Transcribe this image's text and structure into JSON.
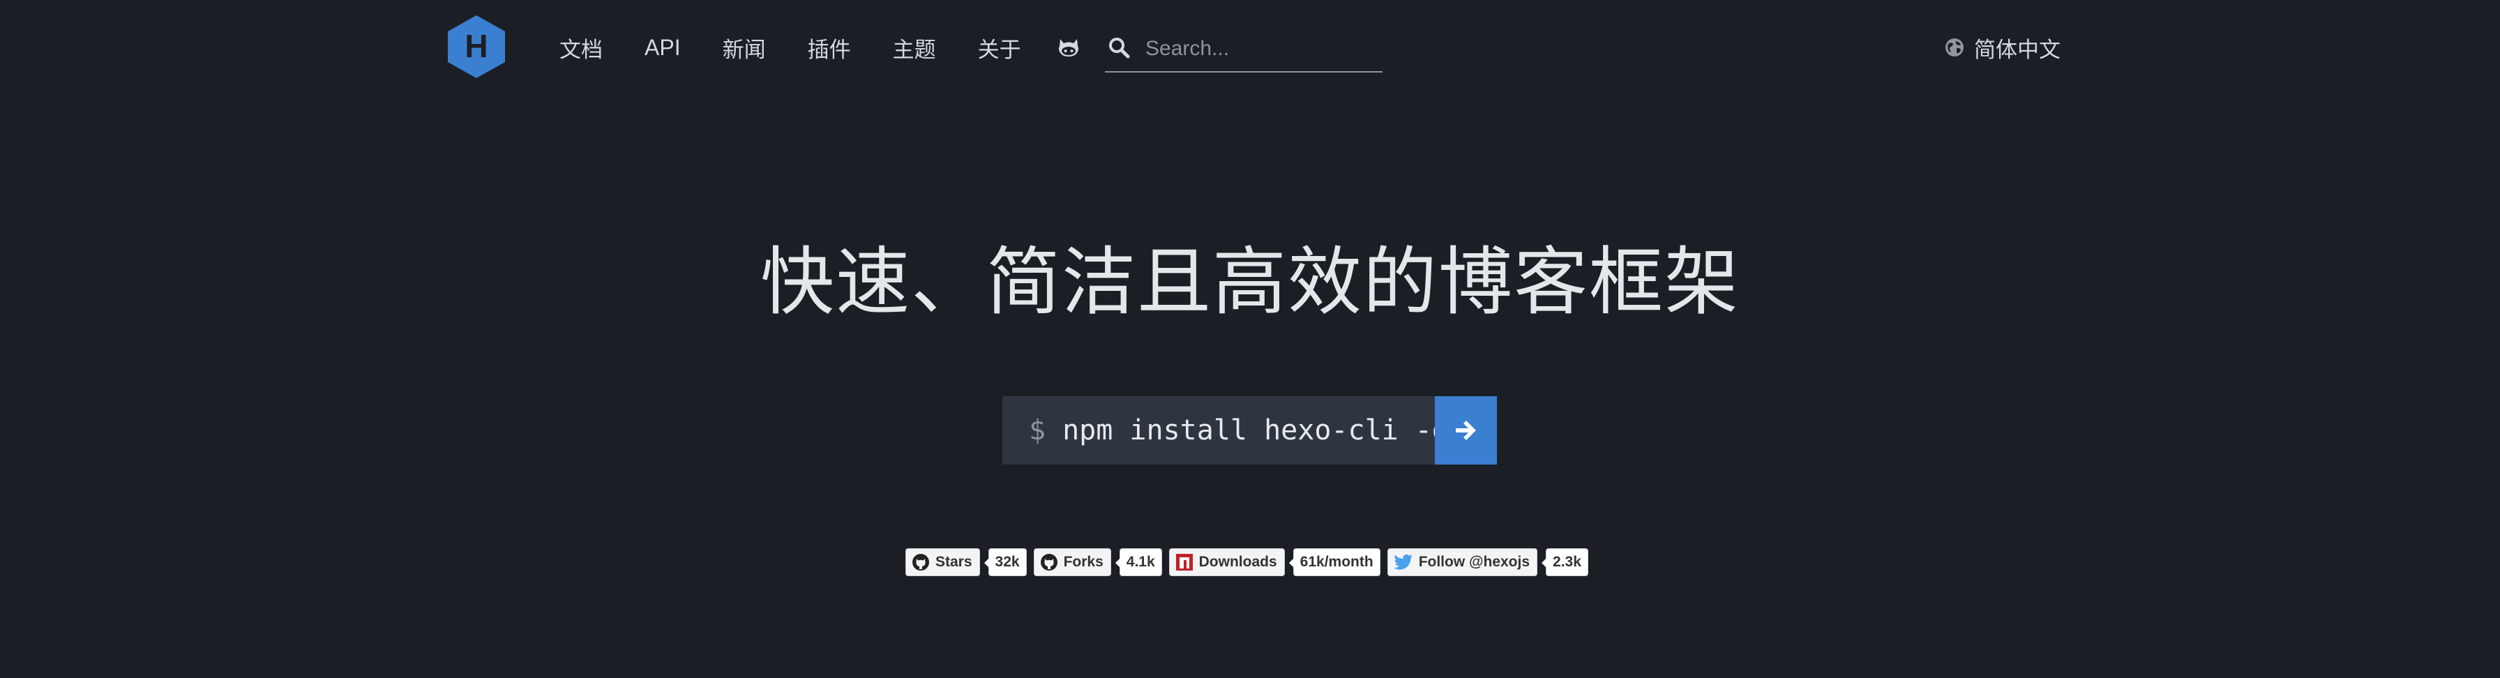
{
  "colors": {
    "background": "#1b1f25",
    "accent": "#3b7fd0",
    "code_background": "#2e3541",
    "logo": "#3b7fd0"
  },
  "header": {
    "logo_letter": "H",
    "nav": [
      {
        "label": "文档"
      },
      {
        "label": "API"
      },
      {
        "label": "新闻"
      },
      {
        "label": "插件"
      },
      {
        "label": "主题"
      },
      {
        "label": "关于"
      }
    ],
    "github_icon": "github-octocat-icon",
    "search": {
      "placeholder": "Search...",
      "value": "",
      "icon": "search-icon"
    },
    "language": {
      "label": "简体中文",
      "icon": "globe-icon"
    }
  },
  "hero": {
    "title": "快速、简洁且高效的博客框架",
    "install": {
      "prompt": "$",
      "command": "npm install hexo-cli -g",
      "button_icon": "arrow-right-icon"
    }
  },
  "badges": [
    {
      "label": "Stars",
      "count": "32k",
      "icon": "github-icon"
    },
    {
      "label": "Forks",
      "count": "4.1k",
      "icon": "github-icon"
    },
    {
      "label": "Downloads",
      "count": "61k/month",
      "icon": "npm-icon"
    },
    {
      "label": "Follow @hexojs",
      "count": "2.3k",
      "icon": "twitter-icon"
    }
  ]
}
